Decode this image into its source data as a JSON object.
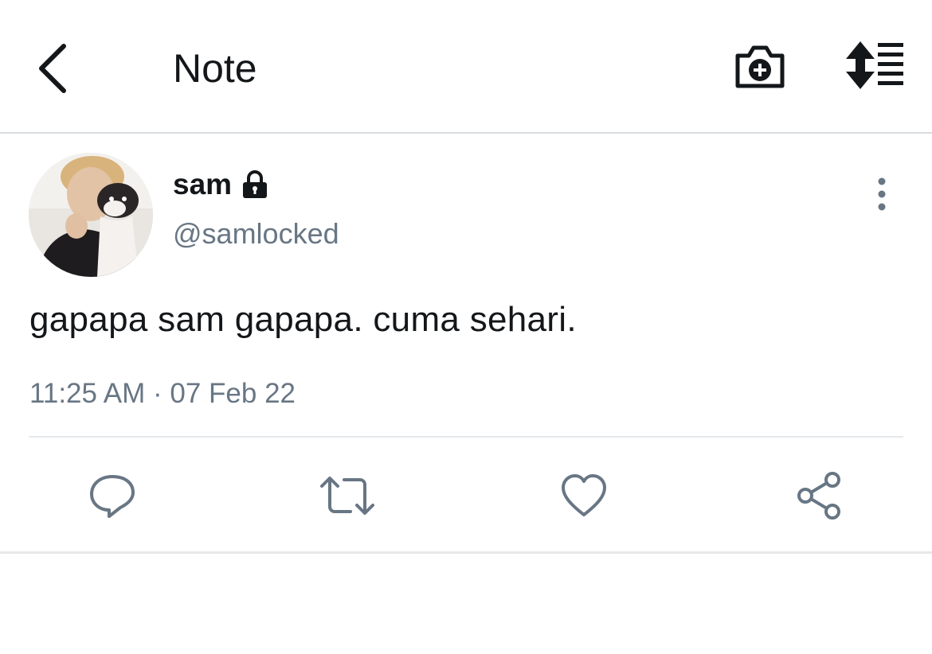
{
  "header": {
    "title": "Note",
    "icons": {
      "back": "chevron-left-icon",
      "camera": "camera-plus-icon",
      "format": "text-format-icon"
    }
  },
  "tweet": {
    "display_name": "sam",
    "handle": "@samlocked",
    "protected": true,
    "text": "gapapa sam gapapa. cuma sehari.",
    "timestamp": "11:25 AM · 07 Feb 22",
    "actions": [
      "reply",
      "retweet",
      "like",
      "share"
    ]
  },
  "colors": {
    "text": "#14171a",
    "secondary_text": "#687684",
    "divider": "#e6e8ea",
    "icon": "#687684"
  }
}
